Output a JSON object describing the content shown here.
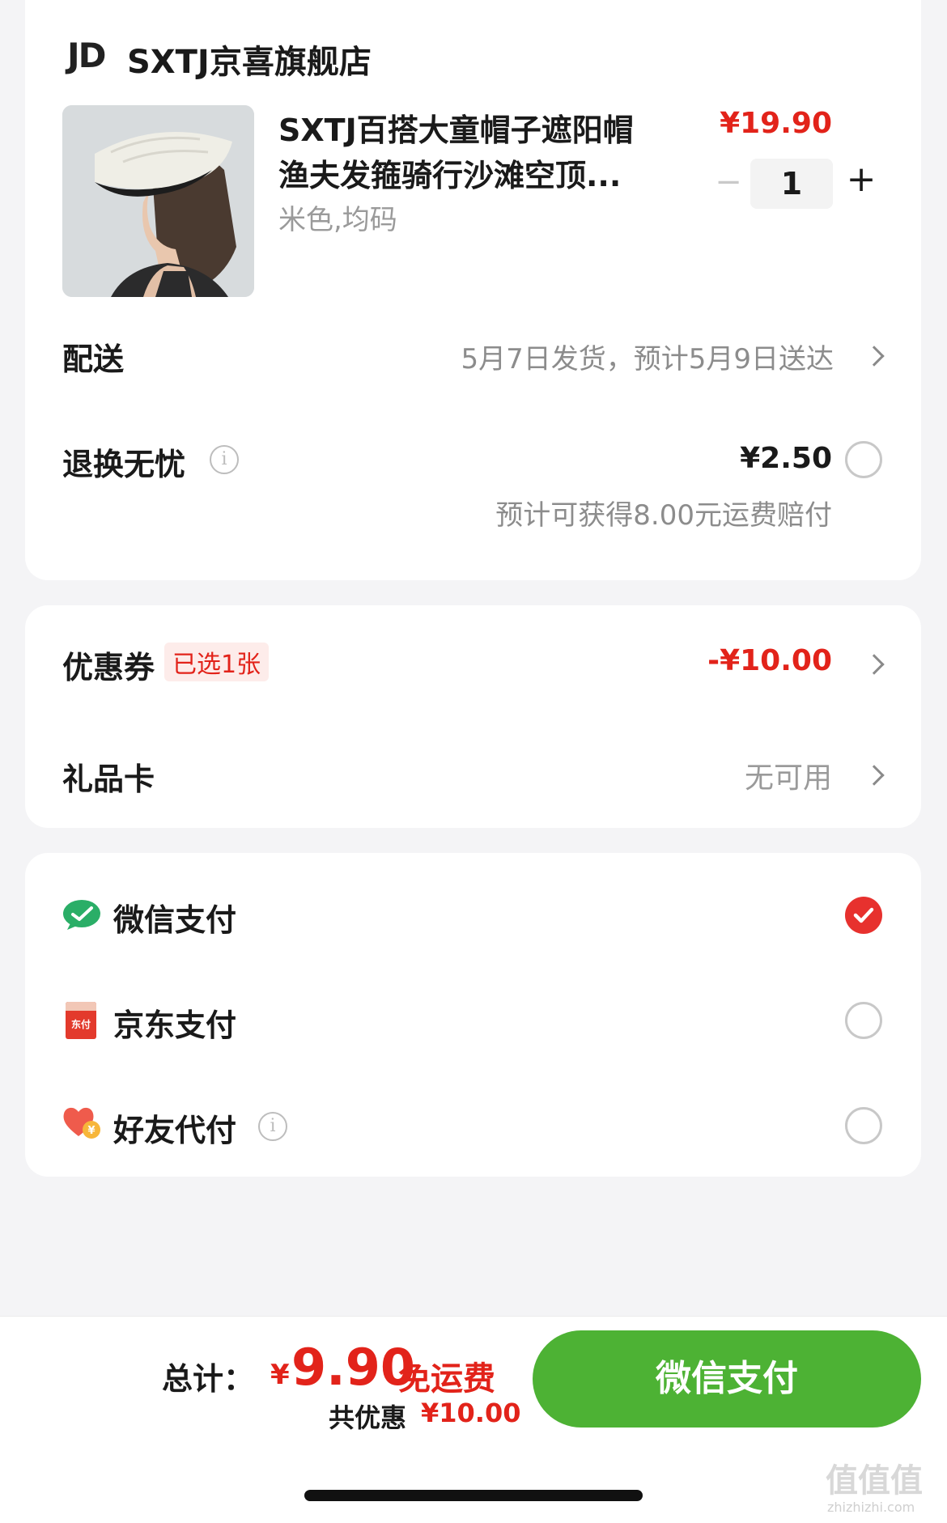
{
  "shop": {
    "logo_text": "JD",
    "name": "SXTJ京喜旗舰店"
  },
  "product": {
    "title_line1": "SXTJ百搭大童帽子遮阳帽",
    "title_line2": "渔夫发箍骑行沙滩空顶...",
    "spec": "米色,均码",
    "price": "¥19.90",
    "quantity": "1",
    "minus": "−",
    "plus": "+"
  },
  "delivery": {
    "label": "配送",
    "value": "5月7日发货，预计5月9日送达"
  },
  "return_insurance": {
    "label": "退换无忧",
    "price": "¥2.50",
    "note": "预计可获得8.00元运费赔付",
    "checked": false
  },
  "coupon": {
    "label": "优惠券",
    "badge": "已选1张",
    "value": "-¥10.00"
  },
  "gift_card": {
    "label": "礼品卡",
    "value": "无可用"
  },
  "payment_methods": [
    {
      "label": "微信支付",
      "icon": "wechat-pay-icon",
      "checked": true
    },
    {
      "label": "京东支付",
      "icon": "jd-pay-icon",
      "icon_text": "东付",
      "checked": false
    },
    {
      "label": "好友代付",
      "icon": "friend-pay-icon",
      "icon_text": "¥",
      "checked": false
    }
  ],
  "footer": {
    "total_label": "总计：",
    "currency": "¥",
    "total_amount": "9.90",
    "free_shipping": "免运费",
    "discount_label": "共优惠",
    "discount_amount": "¥10.00",
    "pay_button": "微信支付"
  },
  "watermark": {
    "text": "值值值",
    "url": "zhizhizhi.com"
  },
  "colors": {
    "accent_red": "#e2231a",
    "wechat_green": "#4db234",
    "background": "#f4f4f6"
  }
}
